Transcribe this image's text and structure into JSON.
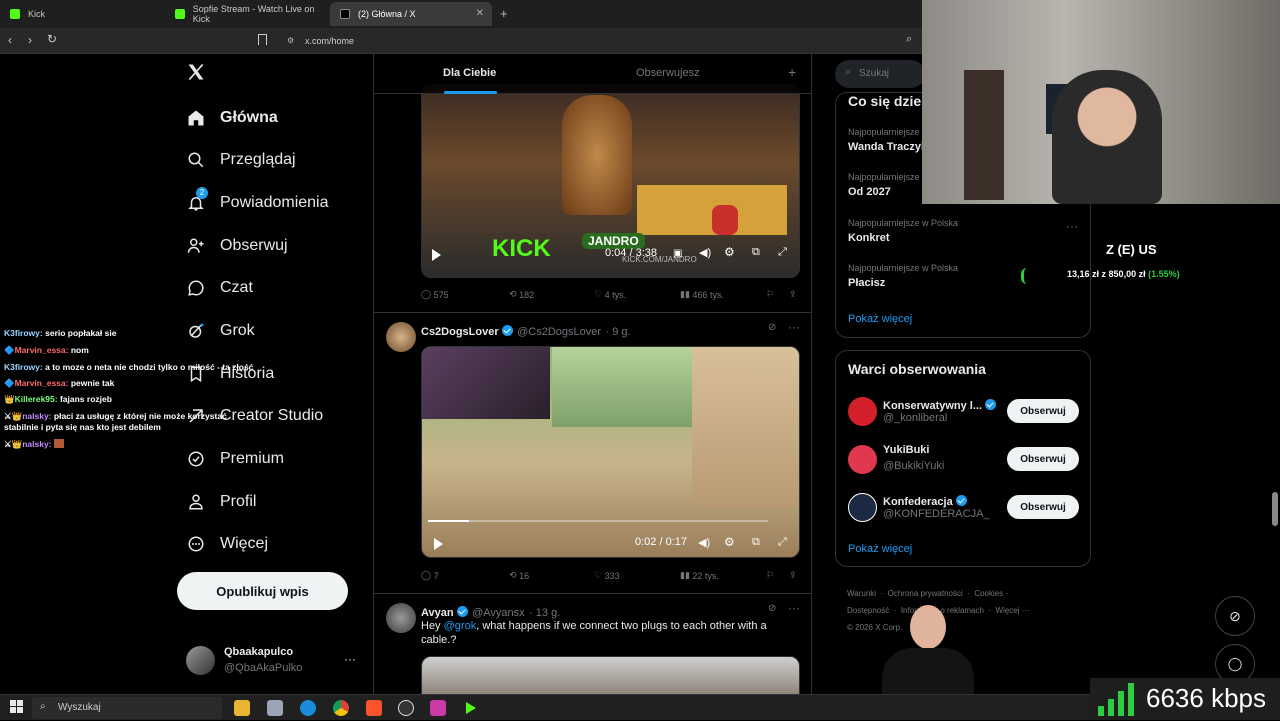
{
  "browser": {
    "tabs": [
      {
        "title": "Kick",
        "color": "#53fc18"
      },
      {
        "title": "Sopfie Stream - Watch Live on Kick",
        "color": "#53fc18"
      },
      {
        "title": "(2) Główna / X",
        "color": "#ffffff"
      }
    ],
    "new_tab": "+",
    "url": "x.com/home"
  },
  "chat": [
    {
      "user": "K3firowy:",
      "msg": "serio popłakał sie",
      "color": "#9bd4ff"
    },
    {
      "user": "Marvin_essa:",
      "msg": "nom",
      "color": "#ff5a5a"
    },
    {
      "user": "K3firowy:",
      "msg": "a to moze o neta nie chodzi tylko o miłość - ta złość",
      "color": "#9bd4ff"
    },
    {
      "user": "Marvin_essa:",
      "msg": "pewnie tak",
      "color": "#ff5a5a"
    },
    {
      "user": "Killerek95:",
      "msg": "fajans rozjeb",
      "color": "#7cfc7c"
    },
    {
      "user": "nalsky:",
      "msg": "płaci za usługę z której nie może korzystać stabilnie i pyta się nas kto jest debilem",
      "color": "#c08cff"
    },
    {
      "user": "nalsky:",
      "msg": "",
      "color": "#c08cff"
    }
  ],
  "nav": {
    "logo": "X",
    "items": [
      {
        "label": "Główna",
        "icon": "home-icon",
        "active": true
      },
      {
        "label": "Przeglądaj",
        "icon": "search-icon"
      },
      {
        "label": "Powiadomienia",
        "icon": "bell-icon",
        "badge": "2"
      },
      {
        "label": "Obserwuj",
        "icon": "person-add-icon"
      },
      {
        "label": "Czat",
        "icon": "chat-icon"
      },
      {
        "label": "Grok",
        "icon": "grok-icon"
      },
      {
        "label": "Historia",
        "icon": "bookmark-icon"
      },
      {
        "label": "Creator Studio",
        "icon": "creator-icon"
      },
      {
        "label": "Premium",
        "icon": "premium-icon"
      },
      {
        "label": "Profil",
        "icon": "profile-icon"
      },
      {
        "label": "Więcej",
        "icon": "more-icon"
      }
    ],
    "post_button": "Opublikuj wpis",
    "account": {
      "name": "Qbaakapulco",
      "handle": "@QbaAkaPulko",
      "more": "···"
    }
  },
  "feed": {
    "tabs": [
      "Dla Ciebie",
      "Obserwujesz"
    ],
    "posts": [
      {
        "video": {
          "time": "0:04 / 3:38",
          "overlay": "KICK",
          "overlay2": "JANDRO",
          "url_overlay": "KICK.COM/JANDRO"
        },
        "stats": {
          "replies": "575",
          "reposts": "182",
          "likes": "4 tys.",
          "views": "466 tys."
        }
      },
      {
        "author": "Cs2DogsLover",
        "handle": "@Cs2DogsLover",
        "time": "· 9 g.",
        "video": {
          "time": "0:02 / 0:17",
          "progress": 0.12
        },
        "stats": {
          "replies": "7",
          "reposts": "16",
          "likes": "333",
          "views": "22 tys."
        }
      },
      {
        "author": "Avyan",
        "handle": "@Avyansx",
        "time": "· 13 g.",
        "text_pre": "Hey ",
        "mention": "@grok",
        "text_post": ", what happens if we connect two plugs to each other with a cable.?"
      }
    ]
  },
  "sidebar": {
    "search_placeholder": "Szukaj",
    "trends_title": "Co się dzie",
    "trends": [
      {
        "meta": "Najpopularniejsze",
        "name": "Wanda Traczyk"
      },
      {
        "meta": "Najpopularniejsze",
        "name": "Od 2027"
      },
      {
        "meta": "Najpopularniejsze w Polska",
        "name": "Konkret"
      },
      {
        "meta": "Najpopularniejsze w Polska",
        "name": "Płacisz"
      }
    ],
    "show_more": "Pokaż więcej",
    "who_title": "Warci obserwowania",
    "who": [
      {
        "name": "Konserwatywny l...",
        "handle": "@_konliberal",
        "verified": true,
        "color": "#d4202b"
      },
      {
        "name": "YukiBuki",
        "handle": "@BukikiYuki",
        "verified": false,
        "color": "#e0394f"
      },
      {
        "name": "Konfederacja",
        "handle": "@KONFEDERACJA_",
        "verified": true,
        "color": "#1c2a44"
      }
    ],
    "follow_label": "Obserwuj",
    "footer": [
      "Warunki",
      "Ochrona prywatności",
      "Cookies",
      "Dostępność",
      "Informacje o reklamach",
      "Więcej ···",
      "© 2026 X Corp."
    ]
  },
  "overlay": {
    "ticker": "Z (E) US",
    "ticker_line": "13,16 zł",
    "ticker_val": "z 850,00 zł",
    "ticker_pct": "(1.55%)",
    "bitrate": "6636 kbps"
  },
  "taskbar": {
    "search": "Wyszukaj"
  }
}
